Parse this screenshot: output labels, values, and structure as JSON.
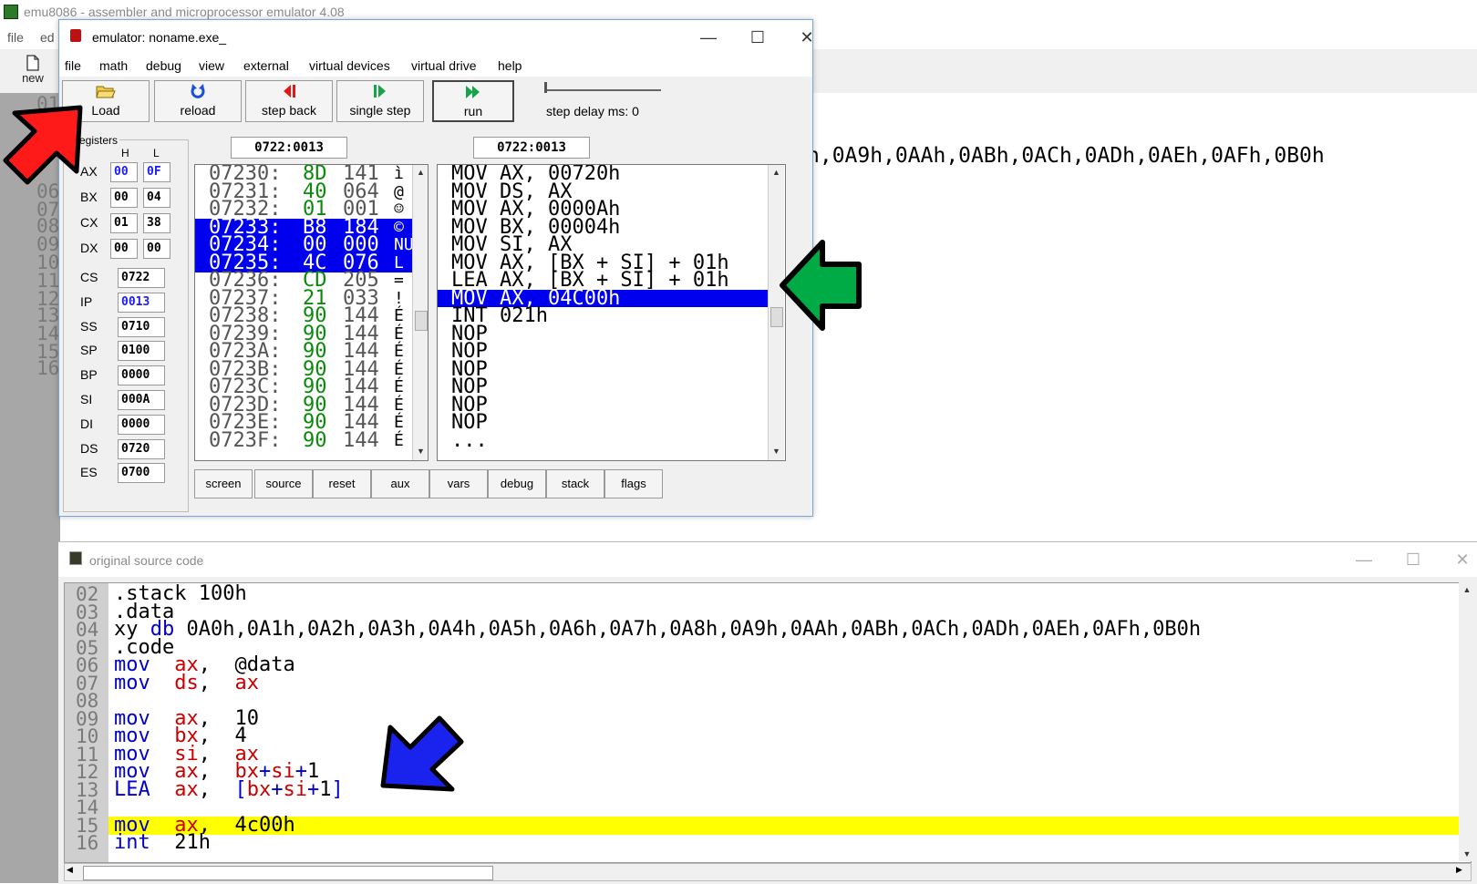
{
  "main_window": {
    "title": "emu8086 - assembler and microprocessor emulator 4.08",
    "menu": [
      "file",
      "ed"
    ],
    "toolbar_new_label": "new",
    "gutter_numbers": [
      "01",
      "06",
      "07",
      "08",
      "09",
      "10",
      "11",
      "12",
      "13",
      "14",
      "15",
      "16"
    ],
    "background_line": "h,0A9h,0AAh,0ABh,0ACh,0ADh,0AEh,0AFh,0B0h"
  },
  "emulator": {
    "title": "emulator: noname.exe_",
    "window_controls": [
      "—",
      "☐",
      "✕"
    ],
    "menu": [
      "file",
      "math",
      "debug",
      "view",
      "external",
      "virtual devices",
      "virtual drive",
      "help"
    ],
    "toolbar": {
      "load": "Load",
      "reload": "reload",
      "step_back": "step back",
      "single_step": "single step",
      "run": "run",
      "step_delay": "step delay ms: 0"
    },
    "registers_label": "egisters",
    "col_h": "H",
    "col_l": "L",
    "registers_hl": [
      {
        "name": "AX",
        "h": "00",
        "l": "0F",
        "changed": true
      },
      {
        "name": "BX",
        "h": "00",
        "l": "04",
        "changed": false
      },
      {
        "name": "CX",
        "h": "01",
        "l": "38",
        "changed": false
      },
      {
        "name": "DX",
        "h": "00",
        "l": "00",
        "changed": false
      }
    ],
    "registers_16": [
      {
        "name": "CS",
        "value": "0722",
        "changed": false
      },
      {
        "name": "IP",
        "value": "0013",
        "changed": true
      },
      {
        "name": "SS",
        "value": "0710",
        "changed": false
      },
      {
        "name": "SP",
        "value": "0100",
        "changed": false
      },
      {
        "name": "BP",
        "value": "0000",
        "changed": false
      },
      {
        "name": "SI",
        "value": "000A",
        "changed": false
      },
      {
        "name": "DI",
        "value": "0000",
        "changed": false
      },
      {
        "name": "DS",
        "value": "0720",
        "changed": false
      },
      {
        "name": "ES",
        "value": "0700",
        "changed": false
      }
    ],
    "mem_address": "0722:0013",
    "dis_address": "0722:0013",
    "memory": [
      {
        "addr": "07230:",
        "hex": "8D",
        "dec": "141",
        "chr": "ì",
        "sel": false
      },
      {
        "addr": "07231:",
        "hex": "40",
        "dec": "064",
        "chr": "@",
        "sel": false
      },
      {
        "addr": "07232:",
        "hex": "01",
        "dec": "001",
        "chr": "☺",
        "sel": false
      },
      {
        "addr": "07233:",
        "hex": "B8",
        "dec": "184",
        "chr": "©",
        "sel": true
      },
      {
        "addr": "07234:",
        "hex": "00",
        "dec": "000",
        "chr": "NU",
        "sel": true
      },
      {
        "addr": "07235:",
        "hex": "4C",
        "dec": "076",
        "chr": "L",
        "sel": true
      },
      {
        "addr": "07236:",
        "hex": "CD",
        "dec": "205",
        "chr": "=",
        "sel": false
      },
      {
        "addr": "07237:",
        "hex": "21",
        "dec": "033",
        "chr": "!",
        "sel": false
      },
      {
        "addr": "07238:",
        "hex": "90",
        "dec": "144",
        "chr": "É",
        "sel": false
      },
      {
        "addr": "07239:",
        "hex": "90",
        "dec": "144",
        "chr": "É",
        "sel": false
      },
      {
        "addr": "0723A:",
        "hex": "90",
        "dec": "144",
        "chr": "É",
        "sel": false
      },
      {
        "addr": "0723B:",
        "hex": "90",
        "dec": "144",
        "chr": "É",
        "sel": false
      },
      {
        "addr": "0723C:",
        "hex": "90",
        "dec": "144",
        "chr": "É",
        "sel": false
      },
      {
        "addr": "0723D:",
        "hex": "90",
        "dec": "144",
        "chr": "É",
        "sel": false
      },
      {
        "addr": "0723E:",
        "hex": "90",
        "dec": "144",
        "chr": "É",
        "sel": false
      },
      {
        "addr": "0723F:",
        "hex": "90",
        "dec": "144",
        "chr": "É",
        "sel": false
      }
    ],
    "disassembly": [
      {
        "text": "MOV AX, 00720h",
        "sel": false
      },
      {
        "text": "MOV DS, AX",
        "sel": false
      },
      {
        "text": "MOV AX, 0000Ah",
        "sel": false
      },
      {
        "text": "MOV BX, 00004h",
        "sel": false
      },
      {
        "text": "MOV SI, AX",
        "sel": false
      },
      {
        "text": "MOV AX, [BX + SI] + 01h",
        "sel": false
      },
      {
        "text": "LEA AX, [BX + SI] + 01h",
        "sel": false
      },
      {
        "text": "MOV AX, 04C00h",
        "sel": true
      },
      {
        "text": "INT 021h",
        "sel": false
      },
      {
        "text": "NOP",
        "sel": false
      },
      {
        "text": "NOP",
        "sel": false
      },
      {
        "text": "NOP",
        "sel": false
      },
      {
        "text": "NOP",
        "sel": false
      },
      {
        "text": "NOP",
        "sel": false
      },
      {
        "text": "NOP",
        "sel": false
      },
      {
        "text": "...",
        "sel": false
      }
    ],
    "bottom_buttons": [
      "screen",
      "source",
      "reset",
      "aux",
      "vars",
      "debug",
      "stack",
      "flags"
    ]
  },
  "source_window": {
    "title": "original source code",
    "window_controls": [
      "—",
      "☐",
      "✕"
    ],
    "lines": [
      {
        "num": "02",
        "parts": [
          {
            "t": ".stack 100h",
            "c": ""
          }
        ]
      },
      {
        "num": "03",
        "parts": [
          {
            "t": ".data",
            "c": ""
          }
        ]
      },
      {
        "num": "04",
        "parts": [
          {
            "t": "xy ",
            "c": ""
          },
          {
            "t": "db",
            "c": "kw"
          },
          {
            "t": " 0A0h,0A1h,0A2h,0A3h,0A4h,0A5h,0A6h,0A7h,0A8h,0A9h,0AAh,0ABh,0ACh,0ADh,0AEh,0AFh,0B0h",
            "c": ""
          }
        ]
      },
      {
        "num": "05",
        "parts": [
          {
            "t": ".code",
            "c": ""
          }
        ]
      },
      {
        "num": "06",
        "parts": [
          {
            "t": "mov",
            "c": "kw"
          },
          {
            "t": "  ",
            "c": ""
          },
          {
            "t": "ax",
            "c": "rg"
          },
          {
            "t": ",  @data",
            "c": ""
          }
        ]
      },
      {
        "num": "07",
        "parts": [
          {
            "t": "mov",
            "c": "kw"
          },
          {
            "t": "  ",
            "c": ""
          },
          {
            "t": "ds",
            "c": "rg"
          },
          {
            "t": ",  ",
            "c": ""
          },
          {
            "t": "ax",
            "c": "rg"
          }
        ]
      },
      {
        "num": "08",
        "parts": []
      },
      {
        "num": "09",
        "parts": [
          {
            "t": "mov",
            "c": "kw"
          },
          {
            "t": "  ",
            "c": ""
          },
          {
            "t": "ax",
            "c": "rg"
          },
          {
            "t": ",  10",
            "c": ""
          }
        ]
      },
      {
        "num": "10",
        "parts": [
          {
            "t": "mov",
            "c": "kw"
          },
          {
            "t": "  ",
            "c": ""
          },
          {
            "t": "bx",
            "c": "rg"
          },
          {
            "t": ",  4",
            "c": ""
          }
        ]
      },
      {
        "num": "11",
        "parts": [
          {
            "t": "mov",
            "c": "kw"
          },
          {
            "t": "  ",
            "c": ""
          },
          {
            "t": "si",
            "c": "rg"
          },
          {
            "t": ",  ",
            "c": ""
          },
          {
            "t": "ax",
            "c": "rg"
          }
        ]
      },
      {
        "num": "12",
        "parts": [
          {
            "t": "mov",
            "c": "kw"
          },
          {
            "t": "  ",
            "c": ""
          },
          {
            "t": "ax",
            "c": "rg"
          },
          {
            "t": ",  ",
            "c": ""
          },
          {
            "t": "bx",
            "c": "rg"
          },
          {
            "t": "+",
            "c": "kw"
          },
          {
            "t": "si",
            "c": "rg"
          },
          {
            "t": "+",
            "c": "kw"
          },
          {
            "t": "1",
            "c": ""
          }
        ]
      },
      {
        "num": "13",
        "parts": [
          {
            "t": "LEA",
            "c": "kw"
          },
          {
            "t": "  ",
            "c": ""
          },
          {
            "t": "ax",
            "c": "rg"
          },
          {
            "t": ",  ",
            "c": ""
          },
          {
            "t": "[",
            "c": "kw"
          },
          {
            "t": "bx",
            "c": "rg"
          },
          {
            "t": "+",
            "c": "kw"
          },
          {
            "t": "si",
            "c": "rg"
          },
          {
            "t": "+",
            "c": "kw"
          },
          {
            "t": "1",
            "c": ""
          },
          {
            "t": "]",
            "c": "kw"
          }
        ]
      },
      {
        "num": "14",
        "parts": []
      },
      {
        "num": "15",
        "parts": [
          {
            "t": "mov",
            "c": "kw"
          },
          {
            "t": "  ",
            "c": ""
          },
          {
            "t": "ax",
            "c": "rg"
          },
          {
            "t": ",  4c00h",
            "c": ""
          }
        ],
        "highlight": true
      },
      {
        "num": "16",
        "parts": [
          {
            "t": "int",
            "c": "kw"
          },
          {
            "t": "  21h",
            "c": ""
          }
        ]
      }
    ]
  },
  "colors": {
    "selection": "#0000ee",
    "current_line": "#ffff00",
    "keyword": "#0000cc",
    "register": "#cc0000",
    "hex_bytes": "#0a8a0a",
    "arrow_red": "#ff1a1a",
    "arrow_green": "#00aa44",
    "arrow_blue": "#1a22ee"
  },
  "icons": {
    "load": "folder-open-icon",
    "reload": "reload-icon",
    "step_back": "step-back-icon",
    "single_step": "single-step-icon",
    "run": "run-icon",
    "new": "new-file-icon"
  }
}
